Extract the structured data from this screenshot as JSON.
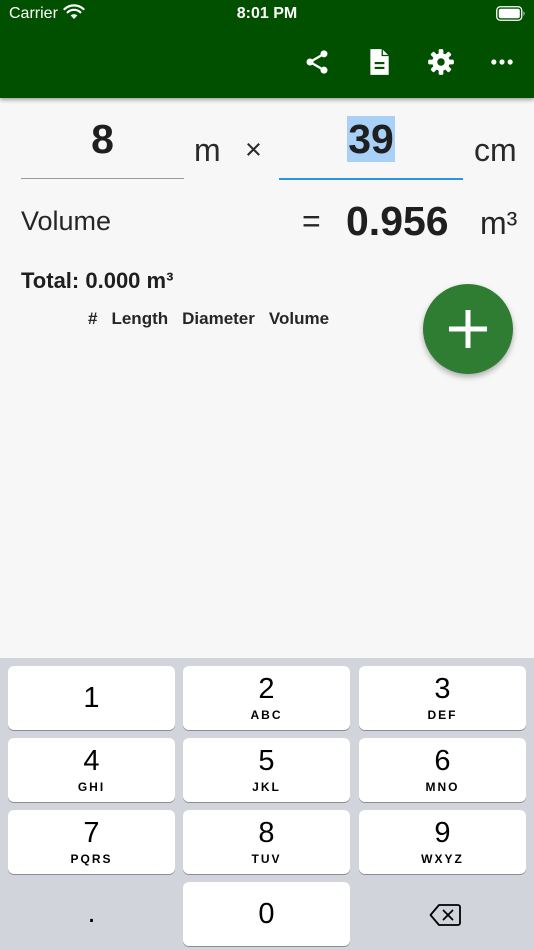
{
  "status_bar": {
    "carrier": "Carrier",
    "time": "8:01 PM"
  },
  "toolbar": {
    "icons": [
      "share-icon",
      "document-icon",
      "gear-icon",
      "more-horizontal-icon"
    ],
    "background_color": "#015000"
  },
  "inputs": {
    "length_value": "8",
    "length_unit": "m",
    "operator": "×",
    "diameter_value": "39",
    "diameter_unit": "cm",
    "focus_color": "#2b94e3"
  },
  "result": {
    "label": "Volume",
    "equals": "=",
    "value": "0.956",
    "unit": "m³"
  },
  "total": {
    "label": "Total: 0.000 m³"
  },
  "table": {
    "columns": [
      "#",
      "Length",
      "Diameter",
      "Volume"
    ]
  },
  "fab": {
    "icon": "plus-icon",
    "color": "#2e7d32"
  },
  "keypad": {
    "keys": [
      {
        "digit": "1",
        "letters": ""
      },
      {
        "digit": "2",
        "letters": "ABC"
      },
      {
        "digit": "3",
        "letters": "DEF"
      },
      {
        "digit": "4",
        "letters": "GHI"
      },
      {
        "digit": "5",
        "letters": "JKL"
      },
      {
        "digit": "6",
        "letters": "MNO"
      },
      {
        "digit": "7",
        "letters": "PQRS"
      },
      {
        "digit": "8",
        "letters": "TUV"
      },
      {
        "digit": "9",
        "letters": "WXYZ"
      }
    ],
    "decimal": ".",
    "zero": "0",
    "backspace_icon": "backspace-icon"
  }
}
